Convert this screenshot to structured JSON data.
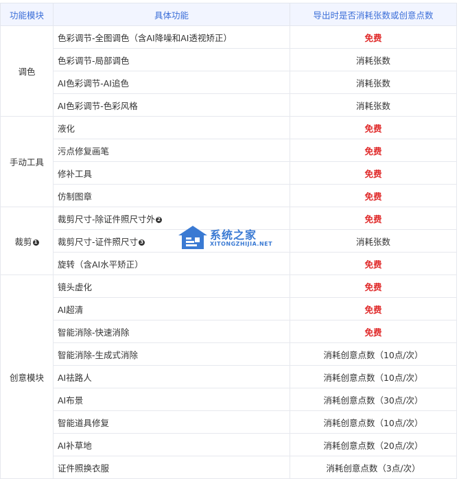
{
  "headers": [
    "功能模块",
    "具体功能",
    "导出时是否消耗张数或创意点数"
  ],
  "modules": [
    {
      "name": "调色",
      "badge": "",
      "rows": [
        {
          "feature": "色彩调节-全图调色（含AI降噪和AI透视矫正）",
          "badge": "",
          "cost": "免费",
          "free": true
        },
        {
          "feature": "色彩调节-局部调色",
          "badge": "",
          "cost": "消耗张数",
          "free": false
        },
        {
          "feature": "AI色彩调节-AI追色",
          "badge": "",
          "cost": "消耗张数",
          "free": false
        },
        {
          "feature": "AI色彩调节-色彩风格",
          "badge": "",
          "cost": "消耗张数",
          "free": false
        }
      ]
    },
    {
      "name": "手动工具",
      "badge": "",
      "rows": [
        {
          "feature": "液化",
          "badge": "",
          "cost": "免费",
          "free": true
        },
        {
          "feature": "污点修复画笔",
          "badge": "",
          "cost": "免费",
          "free": true
        },
        {
          "feature": "修补工具",
          "badge": "",
          "cost": "免费",
          "free": true
        },
        {
          "feature": "仿制图章",
          "badge": "",
          "cost": "免费",
          "free": true
        }
      ]
    },
    {
      "name": "裁剪",
      "badge": "1",
      "rows": [
        {
          "feature": "裁剪尺寸-除证件照尺寸外",
          "badge": "2",
          "cost": "免费",
          "free": true
        },
        {
          "feature": "裁剪尺寸-证件照尺寸",
          "badge": "3",
          "cost": "消耗张数",
          "free": false
        },
        {
          "feature": "旋转（含AI水平矫正）",
          "badge": "",
          "cost": "免费",
          "free": true
        }
      ]
    },
    {
      "name": "创意模块",
      "badge": "",
      "rows": [
        {
          "feature": "镜头虚化",
          "badge": "",
          "cost": "免费",
          "free": true
        },
        {
          "feature": "AI超清",
          "badge": "",
          "cost": "免费",
          "free": true
        },
        {
          "feature": "智能消除-快速消除",
          "badge": "",
          "cost": "免费",
          "free": true
        },
        {
          "feature": "智能消除-生成式消除",
          "badge": "",
          "cost": "消耗创意点数（10点/次）",
          "free": false
        },
        {
          "feature": "AI祛路人",
          "badge": "",
          "cost": "消耗创意点数（10点/次）",
          "free": false
        },
        {
          "feature": "AI布景",
          "badge": "",
          "cost": "消耗创意点数（30点/次）",
          "free": false
        },
        {
          "feature": "智能道具修复",
          "badge": "",
          "cost": "消耗创意点数（10点/次）",
          "free": false
        },
        {
          "feature": "AI补草地",
          "badge": "",
          "cost": "消耗创意点数（20点/次）",
          "free": false
        },
        {
          "feature": "证件照换衣服",
          "badge": "",
          "cost": "消耗创意点数（3点/次）",
          "free": false
        }
      ]
    }
  ],
  "watermark": {
    "title": "系统之家",
    "subtitle": "XITONGZHIJIA.NET",
    "logo": "house-logo-icon",
    "color": "#2a6fd0"
  },
  "colors": {
    "free": "#e02b2b",
    "header_text": "#3b6ed8",
    "header_bg": "#f2f5ff"
  }
}
